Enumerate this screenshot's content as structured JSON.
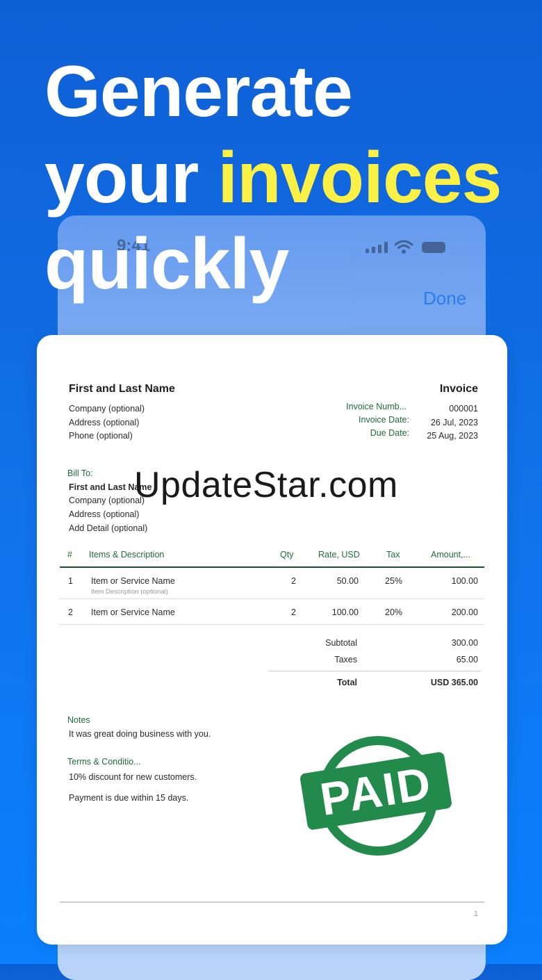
{
  "headline": {
    "line1": "Generate",
    "line2_a": "your ",
    "line2_b": "invoices",
    "line3": "quickly"
  },
  "phone": {
    "time": "9:41",
    "done_label": "Done"
  },
  "invoice": {
    "sender": {
      "name": "First and Last Name",
      "company": "Company (optional)",
      "address": "Address (optional)",
      "phone": "Phone (optional)"
    },
    "title": "Invoice",
    "meta": [
      {
        "label": "Invoice Numb...",
        "value": "000001"
      },
      {
        "label": "Invoice Date:",
        "value": "26 Jul, 2023"
      },
      {
        "label": "Due Date:",
        "value": "25 Aug, 2023"
      }
    ],
    "bill_to": {
      "label": "Bill To:",
      "name": "First and Last Name",
      "company": "Company (optional)",
      "address": "Address (optional)",
      "detail": "Add Detail (optional)"
    },
    "columns": [
      "#",
      "Items & Description",
      "Qty",
      "Rate, USD",
      "Tax",
      "Amount,..."
    ],
    "items": [
      {
        "num": "1",
        "name": "Item or Service Name",
        "desc": "Item Description (optional)",
        "qty": "2",
        "rate": "50.00",
        "tax": "25%",
        "amount": "100.00"
      },
      {
        "num": "2",
        "name": "Item or Service Name",
        "desc": "",
        "qty": "2",
        "rate": "100.00",
        "tax": "20%",
        "amount": "200.00"
      }
    ],
    "totals": {
      "subtotal_label": "Subtotal",
      "subtotal": "300.00",
      "taxes_label": "Taxes",
      "taxes": "65.00",
      "total_label": "Total",
      "total": "USD 365.00"
    },
    "notes_label": "Notes",
    "notes": "It was great doing business with you.",
    "terms_label": "Terms & Conditio...",
    "terms_1": "10% discount for new customers.",
    "terms_2": "Payment is due within 15 days.",
    "page_number": "1",
    "stamp": "PAID"
  },
  "watermark": "UpdateStar.com",
  "colors": {
    "background": "#1173ec",
    "highlight": "#fbf045",
    "accent_green": "#1f6b3e",
    "stamp_green": "#228b4c",
    "done_blue": "#2c7ff0"
  }
}
